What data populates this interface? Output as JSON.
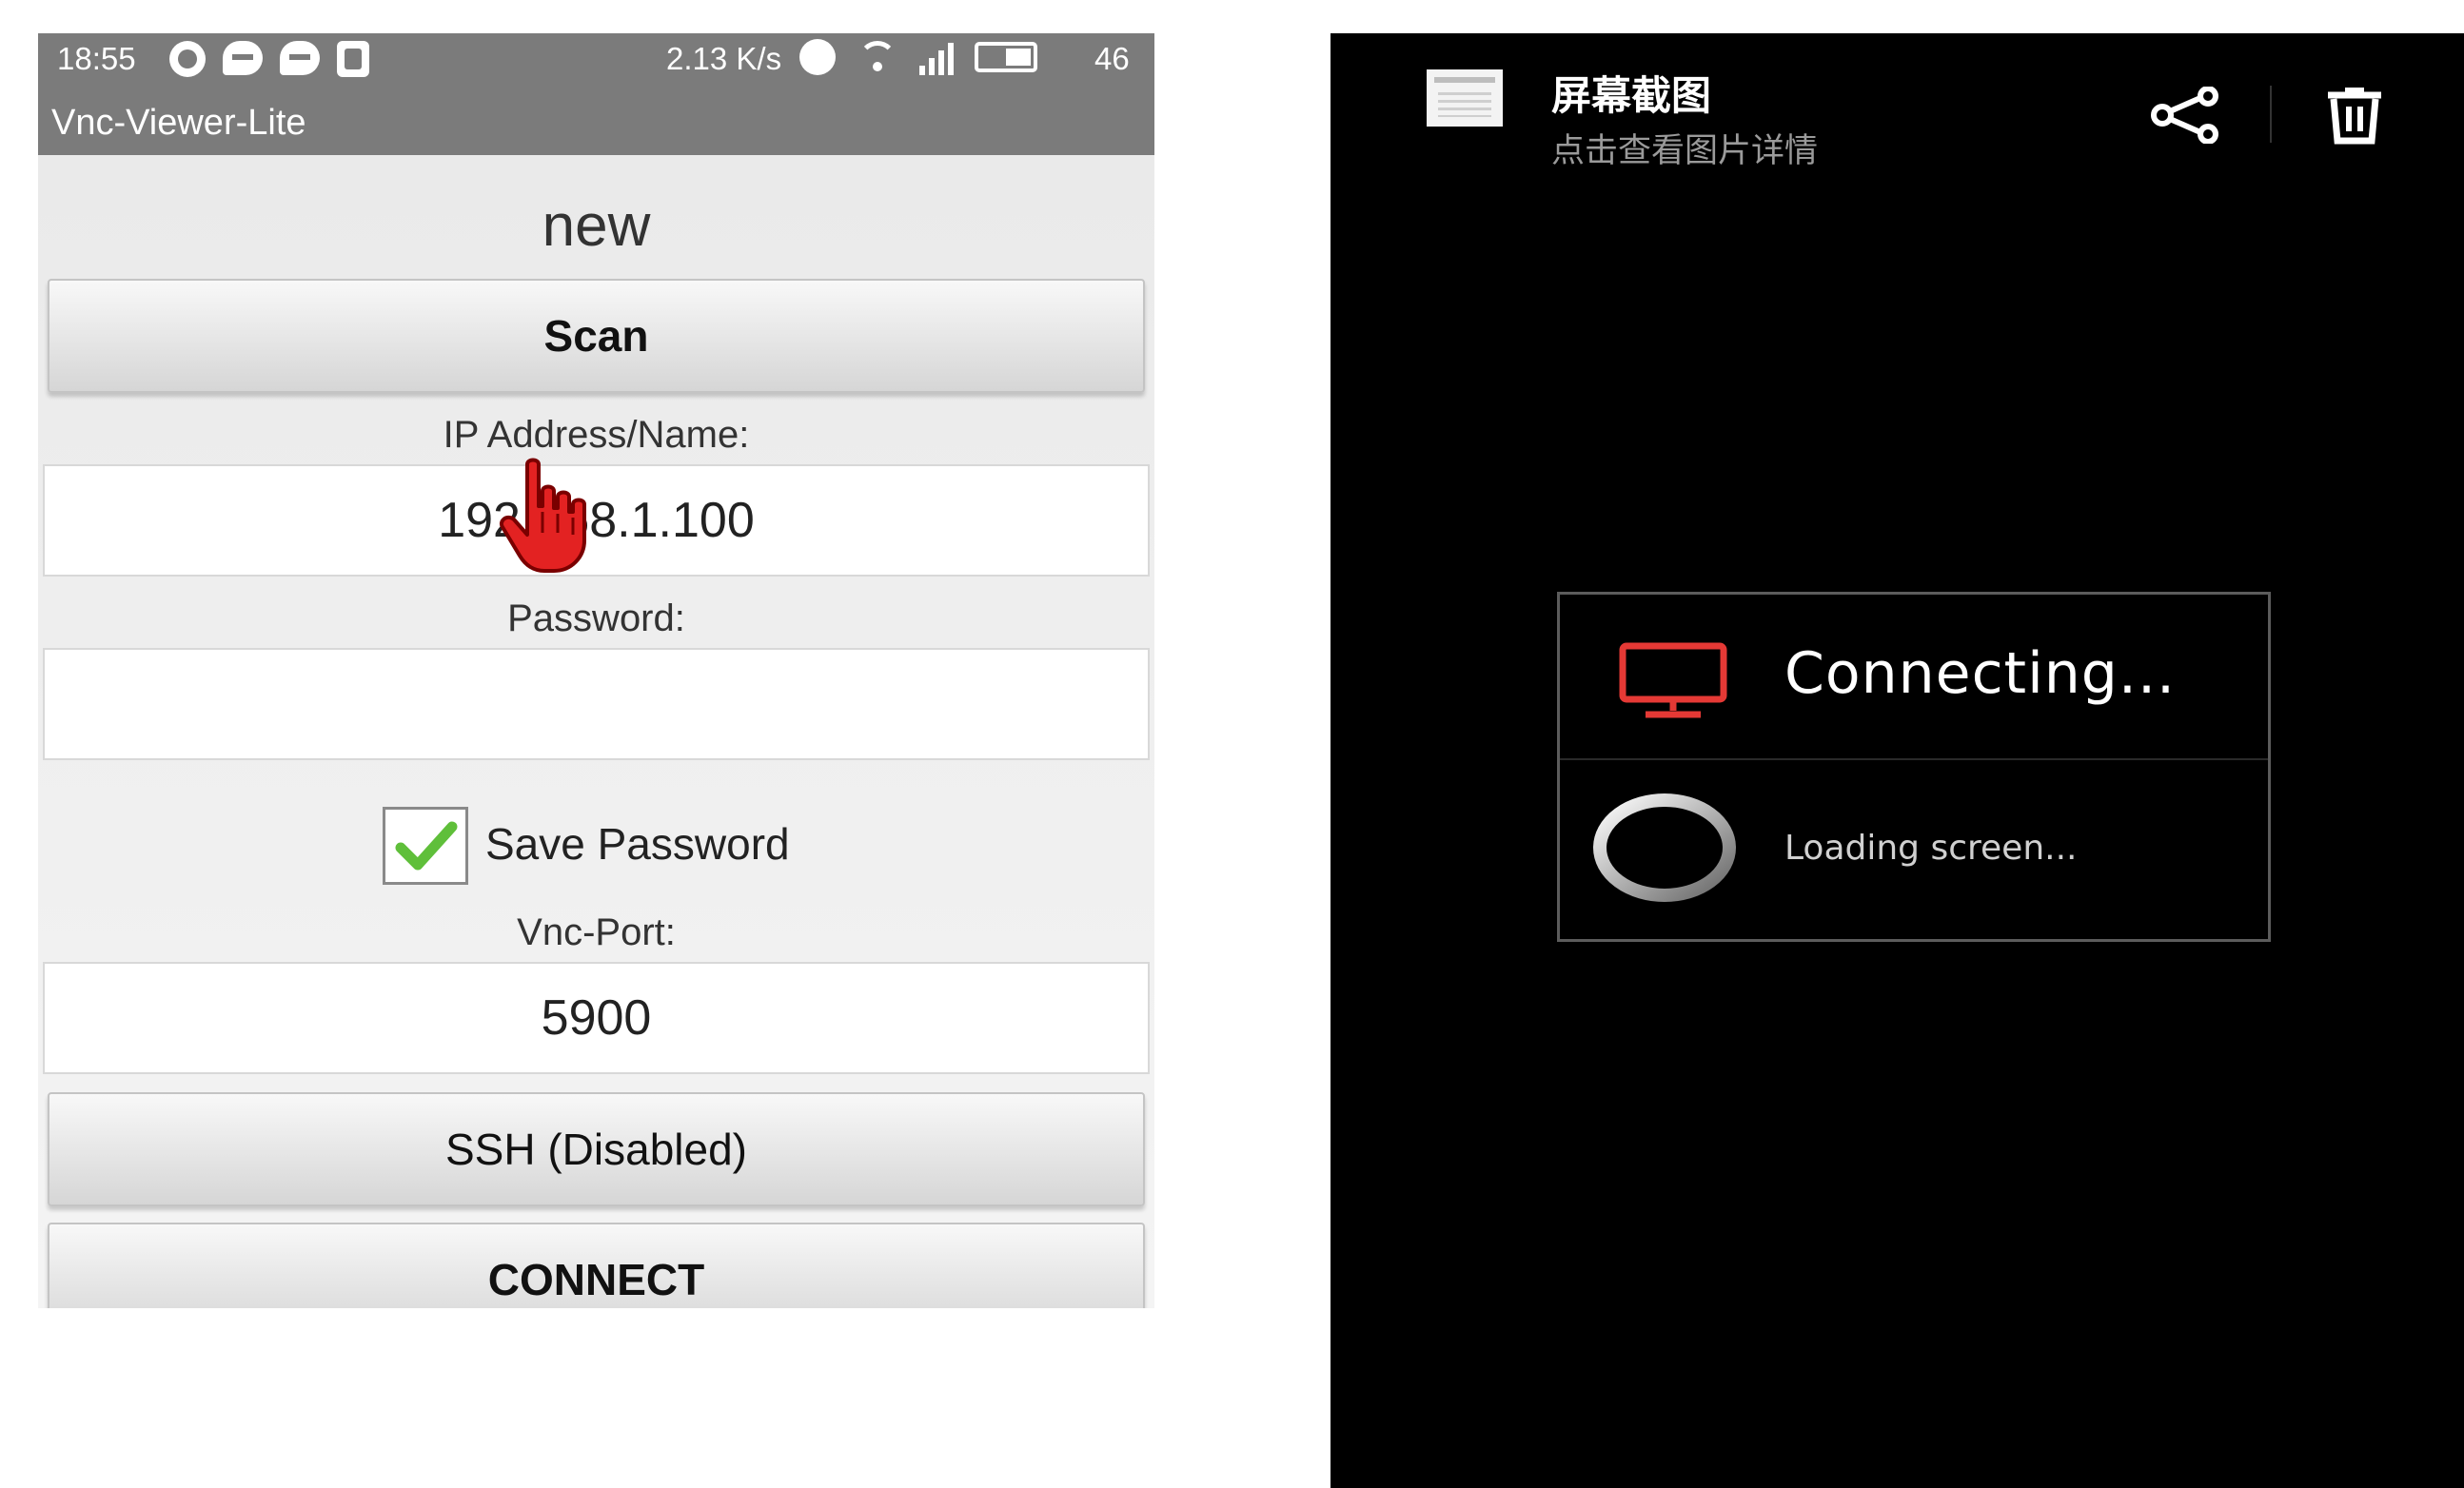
{
  "left_screen": {
    "status_bar": {
      "time": "18:55",
      "network_speed": "2.13 K/s",
      "battery_level": "46"
    },
    "app_title": "Vnc-Viewer-Lite",
    "profile_name": "new",
    "scan_button": "Scan",
    "ip_label": "IP Address/Name:",
    "ip_value": "192.168.1.100",
    "password_label": "Password:",
    "password_value": "",
    "save_password_label": "Save Password",
    "save_password_checked": true,
    "port_label": "Vnc-Port:",
    "port_value": "5900",
    "ssh_button": "SSH (Disabled)",
    "connect_button": "CONNECT"
  },
  "right_screen": {
    "title": "屏幕截图",
    "subtitle": "点击查看图片详情",
    "dialog_title": "Connecting...",
    "dialog_message": "Loading screen...",
    "accent_color": "#e53935"
  }
}
